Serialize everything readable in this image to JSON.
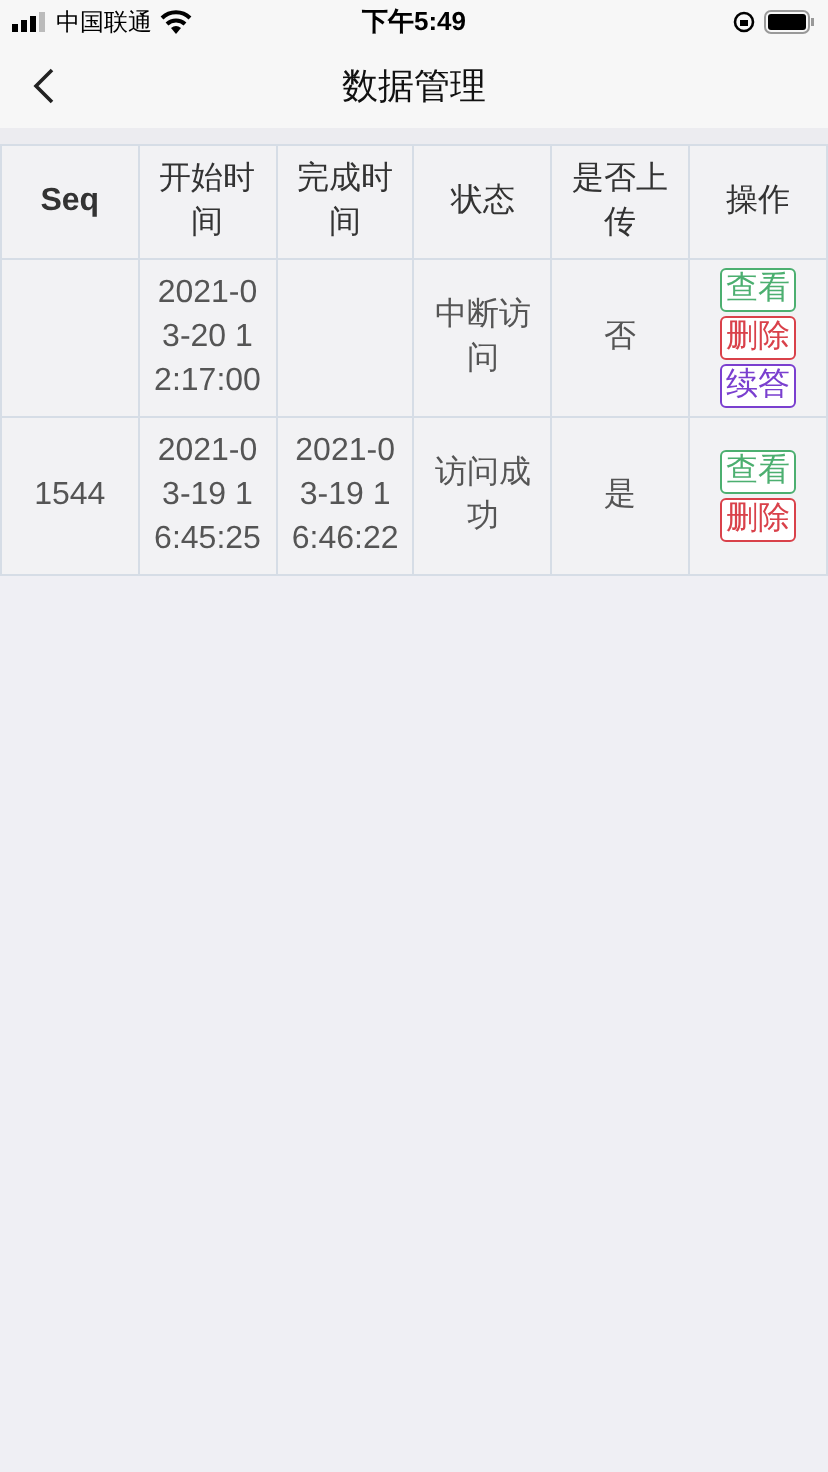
{
  "status_bar": {
    "carrier": "中国联通",
    "time": "下午5:49"
  },
  "nav": {
    "title": "数据管理"
  },
  "table": {
    "columns": [
      "Seq",
      "开始时间",
      "完成时间",
      "状态",
      "是否上传",
      "操作"
    ],
    "rows": [
      {
        "seq": "",
        "start": "2021-03-20 12:17:00",
        "end": "",
        "status": "中断访问",
        "uploaded": "否",
        "actions": [
          {
            "label": "查看",
            "kind": "view"
          },
          {
            "label": "删除",
            "kind": "delete"
          },
          {
            "label": "续答",
            "kind": "resume"
          }
        ]
      },
      {
        "seq": "1544",
        "start": "2021-03-19 16:45:25",
        "end": "2021-03-19 16:46:22",
        "status": "访问成功",
        "uploaded": "是",
        "actions": [
          {
            "label": "查看",
            "kind": "view"
          },
          {
            "label": "删除",
            "kind": "delete"
          }
        ]
      }
    ]
  }
}
